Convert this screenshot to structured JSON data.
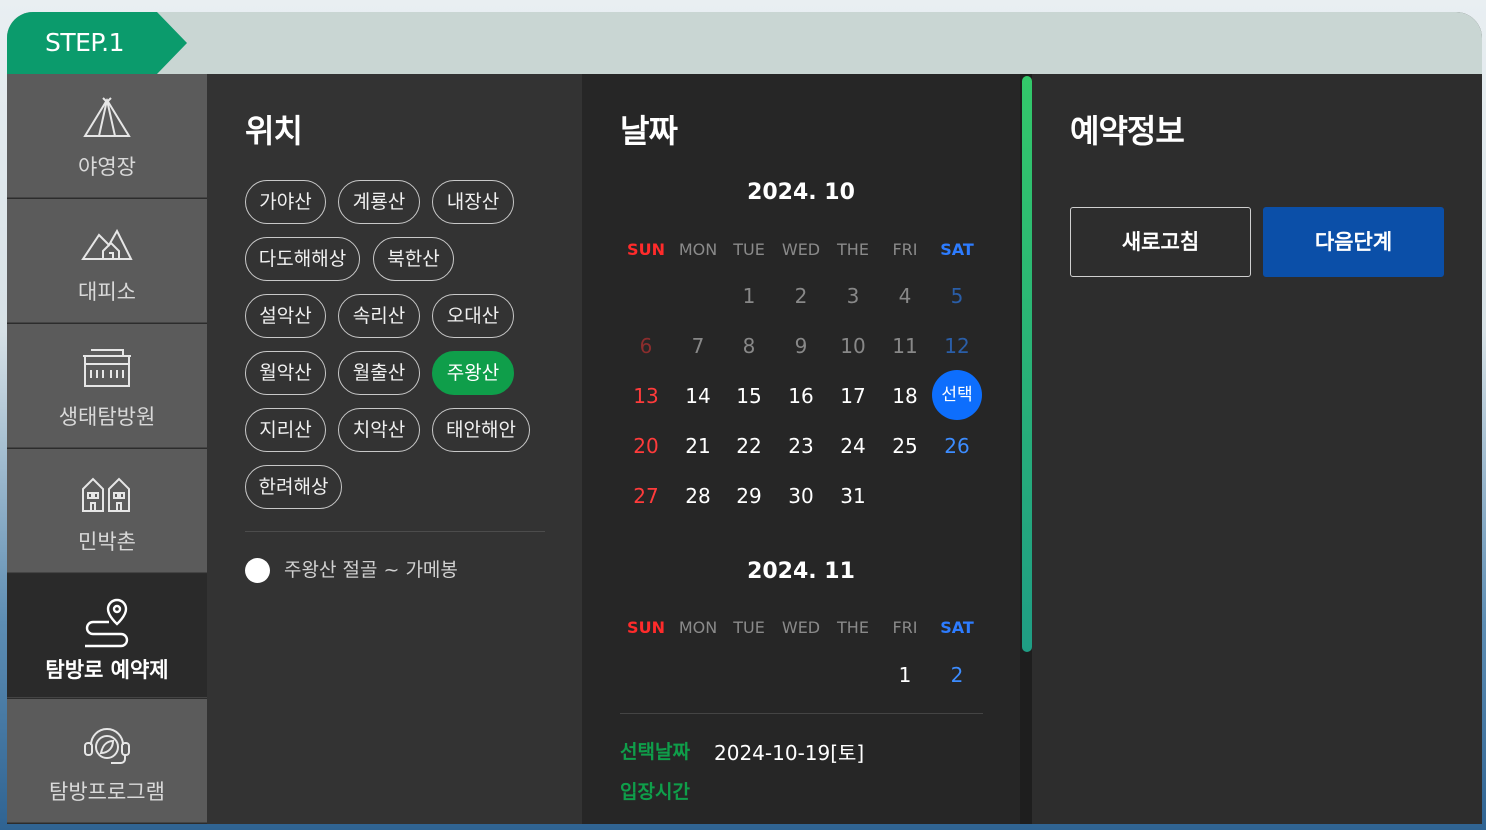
{
  "step": {
    "label": "STEP.1"
  },
  "sidebar": {
    "items": [
      {
        "label": "야영장",
        "icon": "tent-icon"
      },
      {
        "label": "대피소",
        "icon": "shelter-icon"
      },
      {
        "label": "생태탐방원",
        "icon": "building-icon"
      },
      {
        "label": "민박촌",
        "icon": "houses-icon"
      },
      {
        "label": "탐방로 예약제",
        "icon": "route-pin-icon",
        "active": true
      },
      {
        "label": "탐방프로그램",
        "icon": "leaf-headset-icon"
      }
    ]
  },
  "location": {
    "title": "위치",
    "chips": [
      "가야산",
      "계룡산",
      "내장산",
      "다도해해상",
      "북한산",
      "설악산",
      "속리산",
      "오대산",
      "월악산",
      "월출산",
      "주왕산",
      "지리산",
      "치악산",
      "태안해안",
      "한려해상"
    ],
    "selected": "주왕산",
    "route": "주왕산 절골 ~ 가메봉"
  },
  "date": {
    "title": "날짜",
    "weekdays": [
      "SUN",
      "MON",
      "TUE",
      "WED",
      "THE",
      "FRI",
      "SAT"
    ],
    "month1": {
      "title": "2024. 10",
      "days": [
        "1",
        "2",
        "3",
        "4",
        "5",
        "6",
        "7",
        "8",
        "9",
        "10",
        "11",
        "12",
        "13",
        "14",
        "15",
        "16",
        "17",
        "18",
        "선택",
        "20",
        "21",
        "22",
        "23",
        "24",
        "25",
        "26",
        "27",
        "28",
        "29",
        "30",
        "31"
      ]
    },
    "month2": {
      "title": "2024. 11",
      "days": [
        "1",
        "2"
      ]
    },
    "selected_label": "선택날짜",
    "selected_value": "2024-10-19[토]",
    "time_label": "입장시간"
  },
  "reservation": {
    "title": "예약정보",
    "refresh_label": "새로고침",
    "next_label": "다음단계"
  },
  "colors": {
    "accent_green": "#0f9e4a",
    "step_green": "#0b9b6c",
    "next_blue": "#0b4fa8",
    "select_blue": "#0d6efd"
  }
}
